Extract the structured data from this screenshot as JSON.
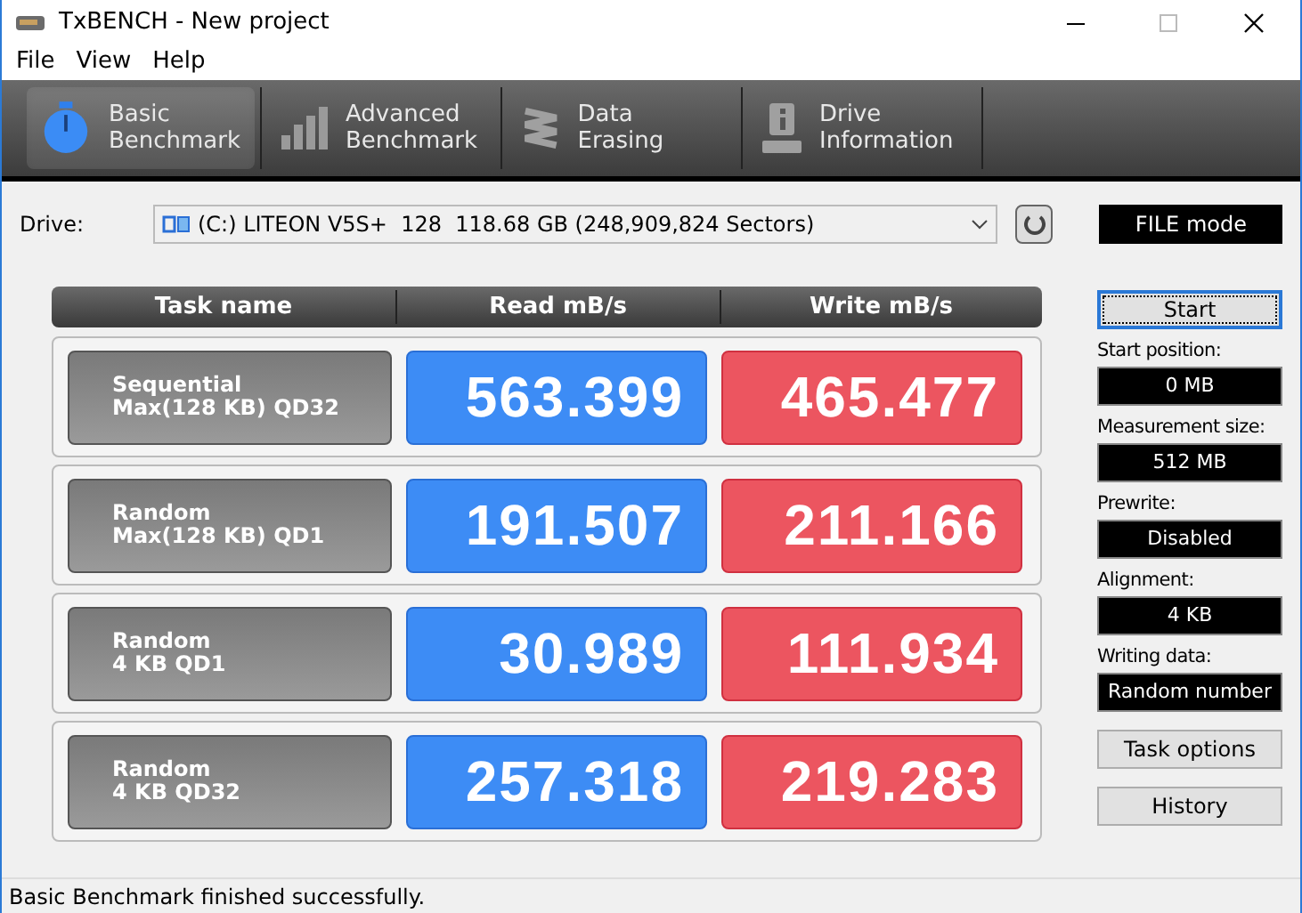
{
  "window": {
    "title": "TxBENCH - New project"
  },
  "menu": [
    "File",
    "View",
    "Help"
  ],
  "tabs": [
    {
      "label": "Basic\nBenchmark",
      "kind": "stopwatch",
      "selected": true
    },
    {
      "label": "Advanced\nBenchmark",
      "kind": "bars",
      "selected": false
    },
    {
      "label": "Data Erasing",
      "kind": "spring",
      "selected": false
    },
    {
      "label": "Drive\nInformation",
      "kind": "info",
      "selected": false
    }
  ],
  "drive": {
    "label": "Drive:",
    "value": "(C:) LITEON V5S+  128  118.68 GB (248,909,824 Sectors)",
    "mode": "FILE mode"
  },
  "table": {
    "columns": [
      "Task name",
      "Read mB/s",
      "Write mB/s"
    ],
    "rows": [
      {
        "task": "Sequential\nMax(128 KB) QD32",
        "read": "563.399",
        "write": "465.477"
      },
      {
        "task": "Random\nMax(128 KB) QD1",
        "read": "191.507",
        "write": "211.166"
      },
      {
        "task": "Random\n4 KB QD1",
        "read": "30.989",
        "write": "111.934"
      },
      {
        "task": "Random\n4 KB QD32",
        "read": "257.318",
        "write": "219.283"
      }
    ]
  },
  "side": {
    "start": "Start",
    "settings": [
      {
        "label": "Start position:",
        "value": "0 MB"
      },
      {
        "label": "Measurement size:",
        "value": "512 MB"
      },
      {
        "label": "Prewrite:",
        "value": "Disabled"
      },
      {
        "label": "Alignment:",
        "value": "4 KB"
      },
      {
        "label": "Writing data:",
        "value": "Random number"
      }
    ],
    "buttons": [
      "Task options",
      "History"
    ]
  },
  "status_bar": "Basic Benchmark finished successfully."
}
